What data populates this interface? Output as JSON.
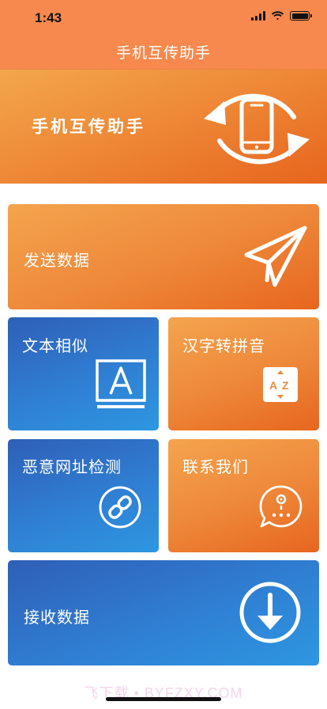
{
  "status_bar": {
    "time": "1:43"
  },
  "nav": {
    "title": "手机互传助手"
  },
  "banner": {
    "text": "手机互传助手",
    "icon": "phone-sync-icon"
  },
  "cards": {
    "send": {
      "label": "发送数据",
      "icon": "paper-plane-icon",
      "color": "#ee8a3b"
    },
    "text_similar": {
      "label": "文本相似",
      "icon": "letter-a-monitor-icon",
      "color": "#2f7fd3"
    },
    "pinyin": {
      "label": "汉字转拼音",
      "icon": "az-sort-icon",
      "color": "#ee8a3b"
    },
    "url_check": {
      "label": "恶意网址检测",
      "icon": "link-icon",
      "color": "#2f7fd3"
    },
    "contact": {
      "label": "联系我们",
      "icon": "chat-bubble-icon",
      "color": "#ee8a3b"
    },
    "receive": {
      "label": "接收数据",
      "icon": "download-arrow-icon",
      "color": "#2f7fd3"
    }
  },
  "watermark": {
    "text": "飞下载 • BYFZXY.COM"
  }
}
